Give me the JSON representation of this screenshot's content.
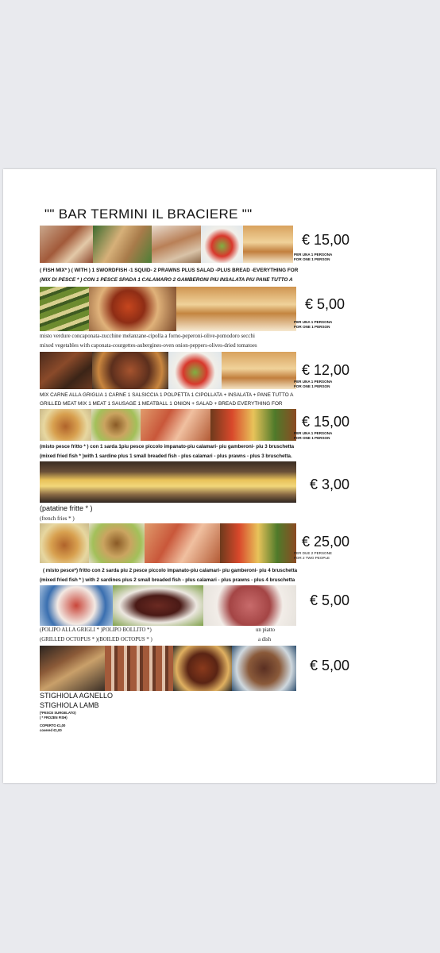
{
  "title": "\"\" BAR TERMINI IL BRACIERE \"\"",
  "items": [
    {
      "price": "€ 15,00",
      "note": [
        "PER UNA 1 PERSONA",
        "FOR ONE 1 PERSON"
      ],
      "lines": [
        "( FISH MIX* ) ( WITH ) 1 SWORDFISH -1 SQUID- 2 PRAWNS PLUS SALAD -PLUS BREAD -EVERYTHING FOR",
        "(MIX DI PESCE * ) CON 1 PESCE SPADA 1  CALAMARO 2 GAMBERONI PIU INSALATA PIU PANE TUTTO A"
      ]
    },
    {
      "price": "€ 5,00",
      "note": [
        "PER UNA 1 PERSONA",
        "FOR ONE 1 PERSON"
      ],
      "lines": [
        "misto verdure concaponata-zucchine melanzane-cipolla a  forno-peperoni-olive-pomodoro secchi",
        "mixed vegetables with caponata-courgettes-aubergines-oven onion-peppers-olives-dried tomatoes"
      ]
    },
    {
      "price": "€ 12,00",
      "note": [
        "PER UNA 1 PERSONA",
        "FOR ONE 1 PERSON"
      ],
      "lines": [
        "MIX CARNE ALLA GRIGLIA 1 CARNE 1 SALSICCIA 1 POLPETTA 1 CIPOLLATA + INSALATA + PANE TUTTO A",
        "GRILLED MEAT MIX 1 MEAT 1 SAUSAGE 1 MEATBALL 1 ONION + SALAD + BREAD EVERYTHING FOR"
      ]
    },
    {
      "price": "€ 15,00",
      "note": [
        "PER UNA 1 PERSONA",
        "FOR ONE 1 PERSON"
      ],
      "lines": [
        "(misto pesce fritto * ) con 1 sarda 1piu  pesce piccolo impanato-piu calamari- piu gamberoni- piu  3 bruschetta",
        "(mixed fried fish * )with 1 sardine plus 1 small breaded fish - plus calamari - plus prawns - plus 3 bruschetta."
      ]
    },
    {
      "price": "€ 3,00",
      "lines": [
        "(patatine fritte * )",
        "(french fries * )"
      ]
    },
    {
      "price": "€ 25,00",
      "note": [
        "PER DUE 2 PERSONE",
        "FOR 2 TWO PEOPLE"
      ],
      "lines": [
        "( misto pesce*) fritto con 2 sarda piu 2  pesce piccolo impanato-piu calamari- piu gamberoni- piu  4  bruschetta",
        "(mixed fried fish * ) with 2 sardines plus 2 small breaded fish - plus calamari - plus prawns - plus 4 bruschetta"
      ]
    },
    {
      "price": "€ 5,00",
      "lines": [
        "(POLIPO ALLA GRIGLI * )POLIPO BOLLITO *)",
        "un piatto",
        "(GRILLED OCTOPUS * )(BOILED OCTOPUS * )",
        "a dish"
      ]
    },
    {
      "price": "€ 5,00",
      "lines": [
        "STIGHIOLA AGNELLO",
        "STIGHIOLA LAMB"
      ]
    }
  ],
  "footer": {
    "frozen_it": "(*PESCE SURGELATO)",
    "frozen_en": "( * FROZEN FISH)",
    "coperto": "COPERTO  €1,00",
    "covered": "covered  €1,00"
  }
}
